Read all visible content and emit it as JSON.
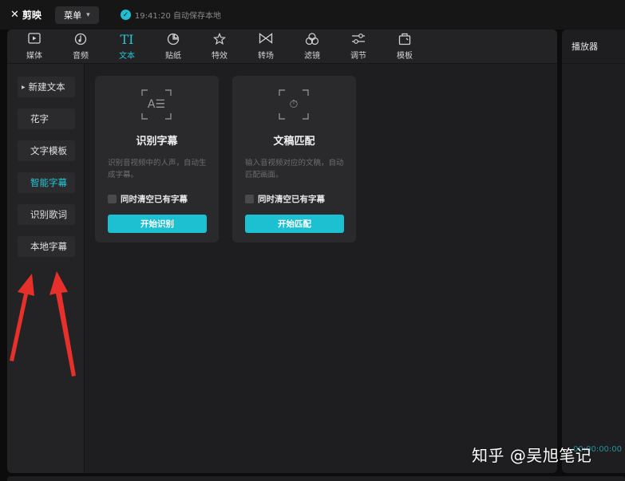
{
  "app": {
    "name": "剪映",
    "menu_label": "菜单",
    "save_status": "19:41:20 自动保存本地"
  },
  "tabs": [
    {
      "label": "媒体",
      "icon": "media-icon"
    },
    {
      "label": "音频",
      "icon": "audio-icon"
    },
    {
      "label": "文本",
      "icon": "text-icon",
      "active": true
    },
    {
      "label": "贴纸",
      "icon": "sticker-icon"
    },
    {
      "label": "特效",
      "icon": "effects-icon"
    },
    {
      "label": "转场",
      "icon": "transition-icon"
    },
    {
      "label": "滤镜",
      "icon": "filter-icon"
    },
    {
      "label": "调节",
      "icon": "adjust-icon"
    },
    {
      "label": "模板",
      "icon": "template-icon"
    }
  ],
  "side_nav": [
    {
      "label": "新建文本",
      "expandable": true
    },
    {
      "label": "花字"
    },
    {
      "label": "文字模板"
    },
    {
      "label": "智能字幕",
      "active": true
    },
    {
      "label": "识别歌词"
    },
    {
      "label": "本地字幕"
    }
  ],
  "cards": [
    {
      "title": "识别字幕",
      "desc": "识别音视频中的人声，自动生成字幕。",
      "checkbox_label": "同时清空已有字幕",
      "button": "开始识别",
      "icon": "recognize-subtitles-icon",
      "glyph": "A☰"
    },
    {
      "title": "文稿匹配",
      "desc": "输入音视频对应的文稿，自动匹配画面。",
      "checkbox_label": "同时清空已有字幕",
      "button": "开始匹配",
      "icon": "script-match-icon",
      "glyph": "⏱"
    }
  ],
  "player": {
    "title": "播放器",
    "timecode": "00:00:00:00"
  },
  "watermark": "知乎 @吴旭笔记",
  "colors": {
    "accent": "#1fc0d1",
    "arrow": "#e8302a",
    "panel": "#1e1e20",
    "background": "#0c0c0d"
  }
}
